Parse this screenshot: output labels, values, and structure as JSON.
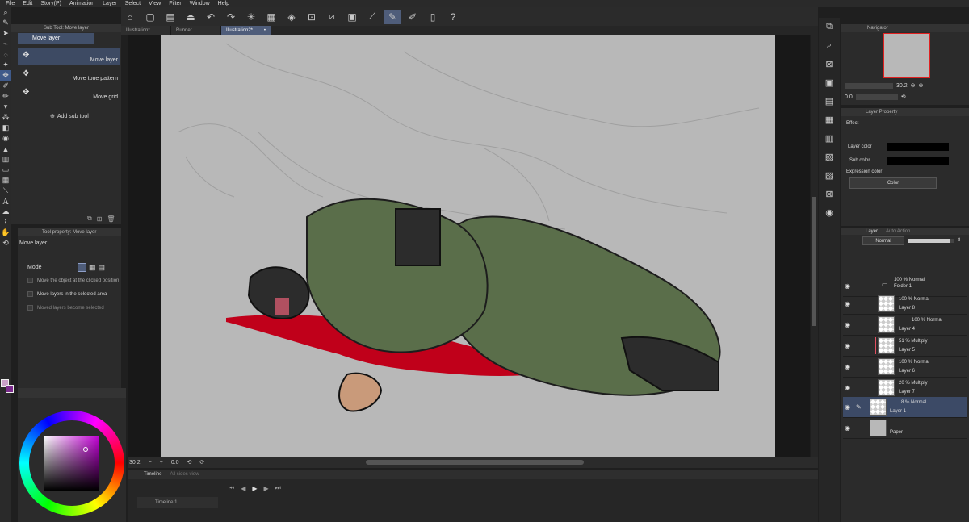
{
  "menu": [
    "File",
    "Edit",
    "Story(P)",
    "Animation",
    "Layer",
    "Select",
    "View",
    "Filter",
    "Window",
    "Help"
  ],
  "subtool": {
    "title": "Sub Tool: Move layer",
    "header": "Move layer",
    "items": [
      {
        "label": "Move layer"
      },
      {
        "label": "Move tone pattern"
      },
      {
        "label": "Move grid"
      }
    ],
    "add_label": "Add sub tool"
  },
  "tool_property": {
    "title": "Tool property: Move layer",
    "name": "Move layer",
    "mode_label": "Mode",
    "options": [
      "Move the object at the clicked position",
      "Move layers in the selected area",
      "Moved layers become selected"
    ]
  },
  "tabs": [
    {
      "label": "Illustration*"
    },
    {
      "label": "Runner"
    },
    {
      "label": "Illustration2*"
    }
  ],
  "status": {
    "zoom": "30.2",
    "angle": "0.0"
  },
  "timeline": {
    "title": "Timeline",
    "title2": "All sides view",
    "track": "Timeline 1"
  },
  "navigator": {
    "title": "Navigator",
    "zoom": "30.2",
    "angle": "0.0"
  },
  "layer_property": {
    "title": "Layer Property",
    "effect_label": "Effect",
    "layer_color_label": "Layer color",
    "sub_color_label": "Sub color",
    "expression_label": "Expression color",
    "expression_value": "Color"
  },
  "layer_panel": {
    "tab1": "Layer",
    "tab2": "Auto Action",
    "blend": "Normal",
    "opacity": "8",
    "folder": {
      "mode": "100 % Normal",
      "name": "Folder 1"
    },
    "layers": [
      {
        "mode": "100 % Normal",
        "name": "Layer 8"
      },
      {
        "mode": "100 % Normal",
        "name": "Layer 4"
      },
      {
        "mode": "51 % Multiply",
        "name": "Layer 5"
      },
      {
        "mode": "100 % Normal",
        "name": "Layer 6"
      },
      {
        "mode": "20 % Multiply",
        "name": "Layer 7"
      },
      {
        "mode": "8 % Normal",
        "name": "Layer 1"
      }
    ],
    "paper": "Paper"
  },
  "colors": {
    "accent": "#4f5d7a",
    "blood": "#c0001a",
    "uniform": "#5a6e4a",
    "main_color": "#c9a0c8",
    "sub_color": "#7b2a8c"
  }
}
